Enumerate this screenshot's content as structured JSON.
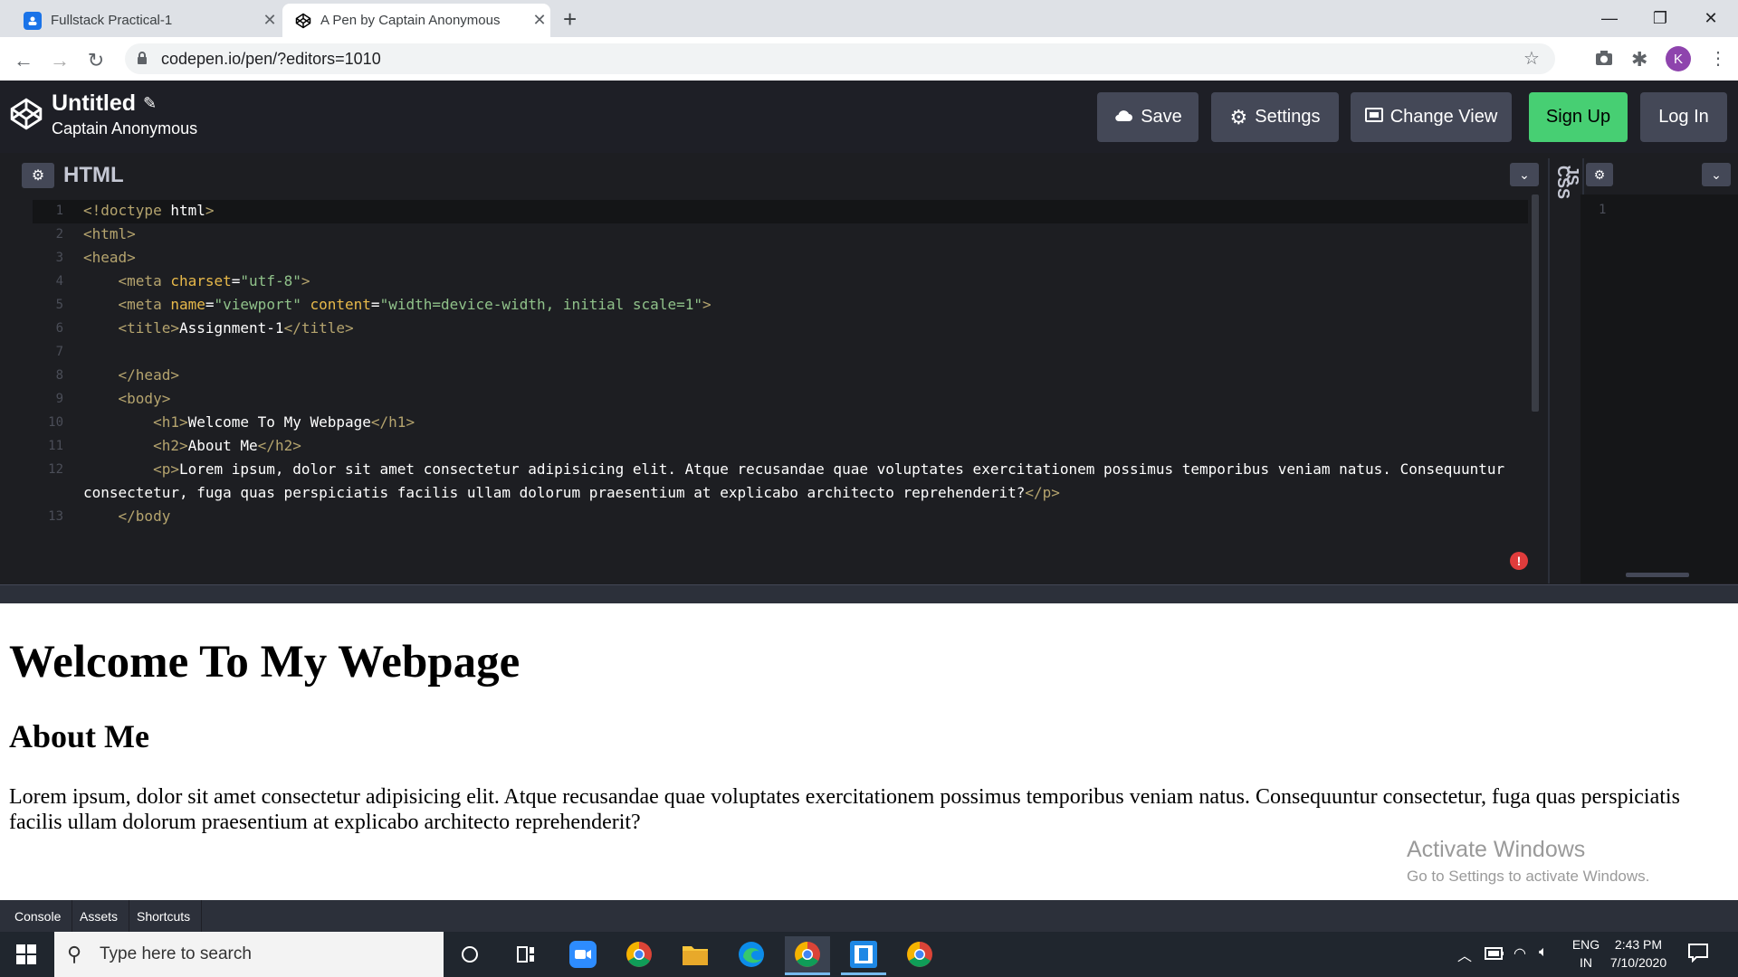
{
  "browser": {
    "tabs": [
      {
        "title": "Fullstack Practical-1",
        "active": false
      },
      {
        "title": "A Pen by Captain Anonymous",
        "active": true
      }
    ],
    "url": "codepen.io/pen/?editors=1010",
    "profile_initial": "K"
  },
  "codepen": {
    "pen_title": "Untitled",
    "author": "Captain Anonymous",
    "buttons": {
      "save": "Save",
      "settings": "Settings",
      "change_view": "Change View",
      "signup": "Sign Up",
      "login": "Log In"
    },
    "html_panel_title": "HTML",
    "collapsed_panels": [
      "CSS",
      "JS"
    ],
    "js_line_number": "1",
    "code_lines": [
      {
        "n": "1",
        "text": "<!doctype html>"
      },
      {
        "n": "2",
        "text": "<html>"
      },
      {
        "n": "3",
        "text": "<head>"
      },
      {
        "n": "4",
        "text": "    <meta charset=\"utf-8\">"
      },
      {
        "n": "5",
        "text": "    <meta name=\"viewport\" content=\"width=device-width, initial scale=1\">"
      },
      {
        "n": "6",
        "text": "    <title>Assignment-1</title>"
      },
      {
        "n": "7",
        "text": ""
      },
      {
        "n": "8",
        "text": "    </head>"
      },
      {
        "n": "9",
        "text": "    <body>"
      },
      {
        "n": "10",
        "text": "        <h1>Welcome To My Webpage</h1>"
      },
      {
        "n": "11",
        "text": "        <h2>About Me</h2>"
      },
      {
        "n": "12",
        "text": "        <p>Lorem ipsum, dolor sit amet consectetur adipisicing elit. Atque recusandae quae voluptates exercitationem possimus temporibus veniam natus. Consequuntur"
      },
      {
        "n": "",
        "text": "consectetur, fuga quas perspiciatis facilis ullam dolorum praesentium at explicabo architecto reprehenderit?</p>"
      },
      {
        "n": "13",
        "text": "    </body"
      }
    ],
    "footer_tabs": [
      "Console",
      "Assets",
      "Shortcuts"
    ]
  },
  "preview": {
    "h1": "Welcome To My Webpage",
    "h2": "About Me",
    "p": "Lorem ipsum, dolor sit amet consectetur adipisicing elit. Atque recusandae quae voluptates exercitationem possimus temporibus veniam natus. Consequuntur consectetur, fuga quas perspiciatis facilis ullam dolorum praesentium at explicabo architecto reprehenderit?"
  },
  "watermark": {
    "title": "Activate Windows",
    "subtitle": "Go to Settings to activate Windows."
  },
  "taskbar": {
    "search_placeholder": "Type here to search",
    "lang": "ENG",
    "region": "IN",
    "time": "2:43 PM",
    "date": "7/10/2020"
  },
  "colors": {
    "codepen_header": "#1e1f26",
    "editor_bg": "#1d1e22",
    "signup_green": "#47cf73",
    "button_gray": "#444857"
  }
}
